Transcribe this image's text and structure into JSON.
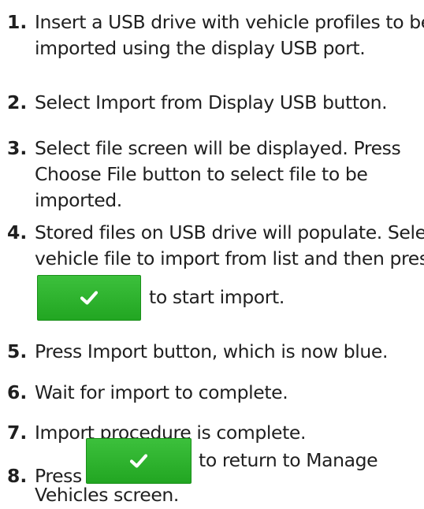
{
  "steps": [
    {
      "num": "1.",
      "lines": [
        "Insert a USB drive with vehicle profiles to be",
        "imported using the display USB port."
      ]
    },
    {
      "num": "2.",
      "lines": [
        "Select Import from Display USB button."
      ]
    },
    {
      "num": "3.",
      "lines": [
        "Select file screen will be displayed. Press",
        "Choose File button to select file to be",
        "imported."
      ]
    },
    {
      "num": "4.",
      "lines": [
        "Stored files on USB drive will populate. Select",
        "vehicle file to import from list and then press"
      ],
      "after_button": "to start import."
    },
    {
      "num": "5.",
      "lines": [
        "Press Import button, which is now blue."
      ]
    },
    {
      "num": "6.",
      "lines": [
        "Wait for import to complete."
      ]
    },
    {
      "num": "7.",
      "lines": [
        "Import procedure is complete."
      ]
    },
    {
      "num": "8.",
      "before_button": "Press",
      "after_button": "to return to Manage",
      "next_line": "Vehicles screen."
    }
  ],
  "icons": {
    "confirm_button_icon": "checkmark-icon"
  },
  "colors": {
    "number": "#1f1f1f",
    "button_green": "#2db52d",
    "checkmark": "#ffffff"
  }
}
